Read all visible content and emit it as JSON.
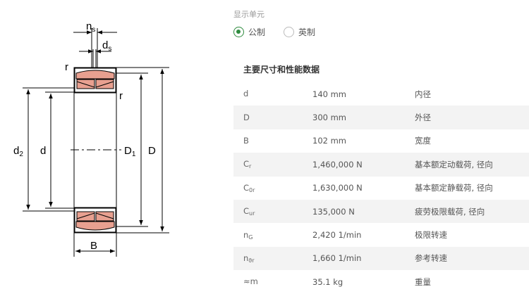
{
  "diagram": {
    "labels": {
      "ns": "n",
      "ns_sub": "s",
      "ds": "d",
      "ds_sub": "s",
      "r_left": "r",
      "r_right": "r",
      "d2": "d",
      "d2_sub": "2",
      "d": "d",
      "D1": "D",
      "D1_sub": "1",
      "D": "D",
      "B": "B"
    },
    "colors": {
      "roller_fill": "#e8a090",
      "line": "#000000"
    }
  },
  "units": {
    "label": "显示单元",
    "options": [
      {
        "label": "公制",
        "selected": true
      },
      {
        "label": "英制",
        "selected": false
      }
    ],
    "accent": "#2e8b3e"
  },
  "specs": {
    "title": "主要尺寸和性能数据",
    "rows": [
      {
        "symbol": "d",
        "sub": "",
        "value": "140 mm",
        "desc": "内径"
      },
      {
        "symbol": "D",
        "sub": "",
        "value": "300 mm",
        "desc": "外径"
      },
      {
        "symbol": "B",
        "sub": "",
        "value": "102 mm",
        "desc": "宽度"
      },
      {
        "symbol": "C",
        "sub": "r",
        "value": "1,460,000 N",
        "desc": "基本额定动载荷, 径向"
      },
      {
        "symbol": "C",
        "sub": "0r",
        "value": "1,630,000 N",
        "desc": "基本额定静载荷, 径向"
      },
      {
        "symbol": "C",
        "sub": "ur",
        "value": "135,000 N",
        "desc": "疲劳极限载荷, 径向"
      },
      {
        "symbol": "n",
        "sub": "G",
        "value": "2,420 1/min",
        "desc": "极限转速"
      },
      {
        "symbol": "n",
        "sub": "ϑr",
        "value": "1,660 1/min",
        "desc": "参考转速"
      },
      {
        "symbol": "≈m",
        "sub": "",
        "value": "35.1 kg",
        "desc": "重量"
      }
    ]
  }
}
